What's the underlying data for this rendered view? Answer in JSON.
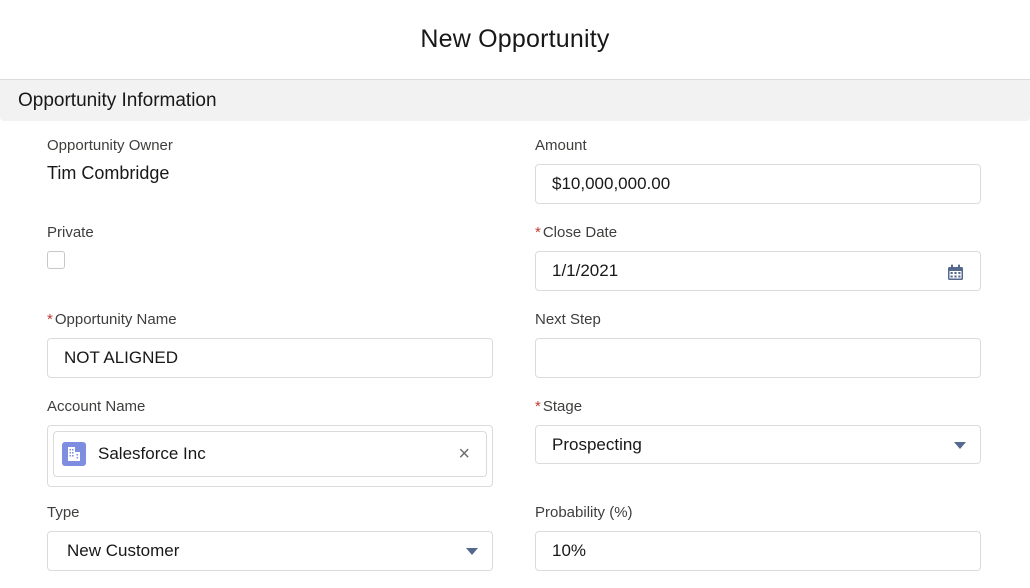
{
  "modal": {
    "title": "New Opportunity"
  },
  "section": {
    "title": "Opportunity Information"
  },
  "fields": {
    "owner": {
      "label": "Opportunity Owner",
      "value": "Tim Combridge"
    },
    "private": {
      "label": "Private",
      "checked": false
    },
    "opportunity_name": {
      "required": "*",
      "label": "Opportunity Name",
      "value": "NOT ALIGNED"
    },
    "account_name": {
      "label": "Account Name",
      "value": "Salesforce Inc",
      "clear": "×"
    },
    "type": {
      "label": "Type",
      "value": "New Customer"
    },
    "amount": {
      "label": "Amount",
      "value": "$10,000,000.00"
    },
    "close_date": {
      "required": "*",
      "label": "Close Date",
      "value": "1/1/2021"
    },
    "next_step": {
      "label": "Next Step",
      "value": ""
    },
    "stage": {
      "required": "*",
      "label": "Stage",
      "value": "Prospecting"
    },
    "probability": {
      "label": "Probability (%)",
      "value": "10%"
    }
  },
  "icons": {
    "calendar": "calendar-icon",
    "dropdown": "chevron-down-icon",
    "account": "account-icon",
    "clear": "close-icon"
  },
  "colors": {
    "required": "#c23934",
    "account_icon": "#7f8de1",
    "caret": "#54698d",
    "section_bg": "#f3f2f2"
  }
}
